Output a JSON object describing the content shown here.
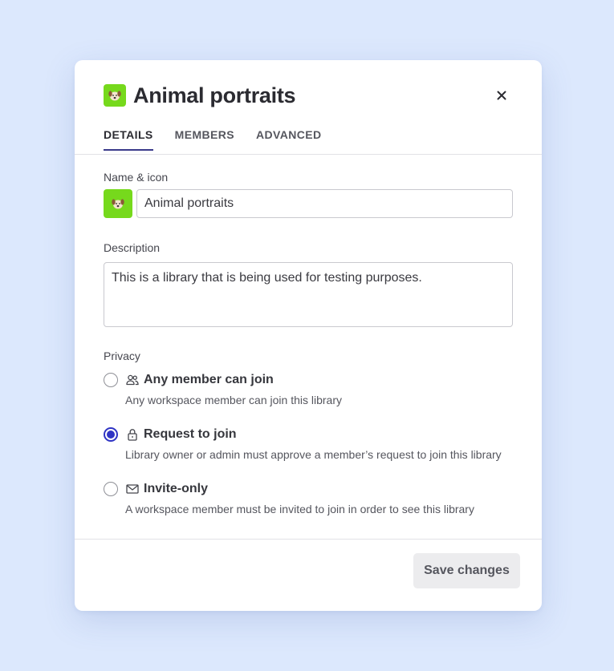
{
  "dialog": {
    "title": "Animal portraits",
    "icon": "dog-face-icon",
    "icon_bg": "#76d91c",
    "close_icon": "close-icon"
  },
  "tabs": [
    {
      "label": "DETAILS",
      "active": true
    },
    {
      "label": "MEMBERS",
      "active": false
    },
    {
      "label": "ADVANCED",
      "active": false
    }
  ],
  "form": {
    "name_label": "Name & icon",
    "name_value": "Animal portraits",
    "description_label": "Description",
    "description_value": "This is a library that is being used for testing purposes.",
    "privacy_label": "Privacy"
  },
  "privacy_options": [
    {
      "title": "Any member can join",
      "description": "Any workspace member can join this library",
      "icon": "people-icon",
      "selected": false
    },
    {
      "title": "Request to join",
      "description": "Library owner or admin must approve a member’s request to join this library",
      "icon": "lock-icon",
      "selected": true
    },
    {
      "title": "Invite-only",
      "description": "A workspace member must be invited to join in order to see this library",
      "icon": "mail-icon",
      "selected": false
    }
  ],
  "footer": {
    "save_label": "Save changes"
  },
  "colors": {
    "accent": "#2f34c4",
    "background": "#dce8fd"
  }
}
